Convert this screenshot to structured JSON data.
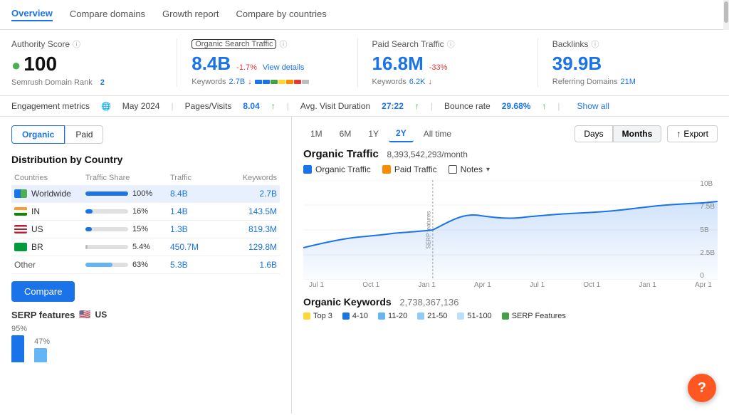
{
  "nav": {
    "items": [
      "Overview",
      "Compare domains",
      "Growth report",
      "Compare by countries"
    ],
    "active": "Overview"
  },
  "metrics": {
    "authority_score": {
      "label": "Authority Score",
      "value": "100",
      "sub": "Semrush Domain Rank 2"
    },
    "organic_search": {
      "label": "Organic Search Traffic",
      "value": "8.4B",
      "badge": "-1.7%",
      "view_details": "View details",
      "sub_label": "Keywords",
      "sub_value": "2.7B"
    },
    "paid_search": {
      "label": "Paid Search Traffic",
      "value": "16.8M",
      "badge": "-33%",
      "sub_label": "Keywords",
      "sub_value": "6.2K"
    },
    "backlinks": {
      "label": "Backlinks",
      "value": "39.9B",
      "sub_label": "Referring Domains",
      "sub_value": "21M"
    }
  },
  "engagement": {
    "label": "Engagement metrics",
    "date": "May 2024",
    "pages_visits_label": "Pages/Visits",
    "pages_visits_value": "8.04",
    "avg_visit_label": "Avg. Visit Duration",
    "avg_visit_value": "27:22",
    "bounce_rate_label": "Bounce rate",
    "bounce_rate_value": "29.68%",
    "show_all": "Show all"
  },
  "left": {
    "tabs": [
      "Organic",
      "Paid"
    ],
    "active_tab": "Organic",
    "section_title": "Distribution by Country",
    "table_headers": [
      "Countries",
      "Traffic Share",
      "Traffic",
      "Keywords"
    ],
    "rows": [
      {
        "name": "Worldwide",
        "flag": "worldwide",
        "share": "100%",
        "traffic": "8.4B",
        "keywords": "2.7B",
        "bar_pct": 100,
        "highlighted": true
      },
      {
        "name": "IN",
        "flag": "in",
        "share": "16%",
        "traffic": "1.4B",
        "keywords": "143.5M",
        "bar_pct": 16
      },
      {
        "name": "US",
        "flag": "us",
        "share": "15%",
        "traffic": "1.3B",
        "keywords": "819.3M",
        "bar_pct": 15
      },
      {
        "name": "BR",
        "flag": "br",
        "share": "5.4%",
        "traffic": "450.7M",
        "keywords": "129.8M",
        "bar_pct": 5
      },
      {
        "name": "Other",
        "flag": "other",
        "share": "63%",
        "traffic": "5.3B",
        "keywords": "1.6B",
        "bar_pct": 63
      }
    ],
    "compare_label": "Compare",
    "serp_title": "SERP features",
    "serp_country": "US",
    "serp_pcts": [
      "95%",
      "47%"
    ],
    "serp_bars": [
      {
        "height": 38,
        "color": "#1a73e8"
      },
      {
        "height": 20,
        "color": "#64b5f6"
      }
    ]
  },
  "right": {
    "time_buttons": [
      "1M",
      "6M",
      "1Y",
      "2Y",
      "All time"
    ],
    "active_time": "2Y",
    "view_buttons": [
      "Days",
      "Months"
    ],
    "active_view": "Months",
    "export_label": "Export",
    "chart_title": "Organic Traffic",
    "chart_value": "8,393,542,293/month",
    "legend": {
      "organic": "Organic Traffic",
      "paid": "Paid Traffic",
      "notes": "Notes"
    },
    "chart_x_labels": [
      "Jul 1",
      "Oct 1",
      "Jan 1",
      "Apr 1",
      "Jul 1",
      "Oct 1",
      "Jan 1",
      "Apr 1"
    ],
    "chart_y_labels": [
      "10B",
      "7.5B",
      "5B",
      "2.5B",
      "0"
    ],
    "serp_annotation": "SERP features",
    "keywords_title": "Organic Keywords",
    "keywords_count": "2,738,367,136",
    "kw_legend": [
      "Top 3",
      "4-10",
      "11-20",
      "21-50",
      "51-100",
      "SERP Features"
    ]
  },
  "help_btn": "?"
}
